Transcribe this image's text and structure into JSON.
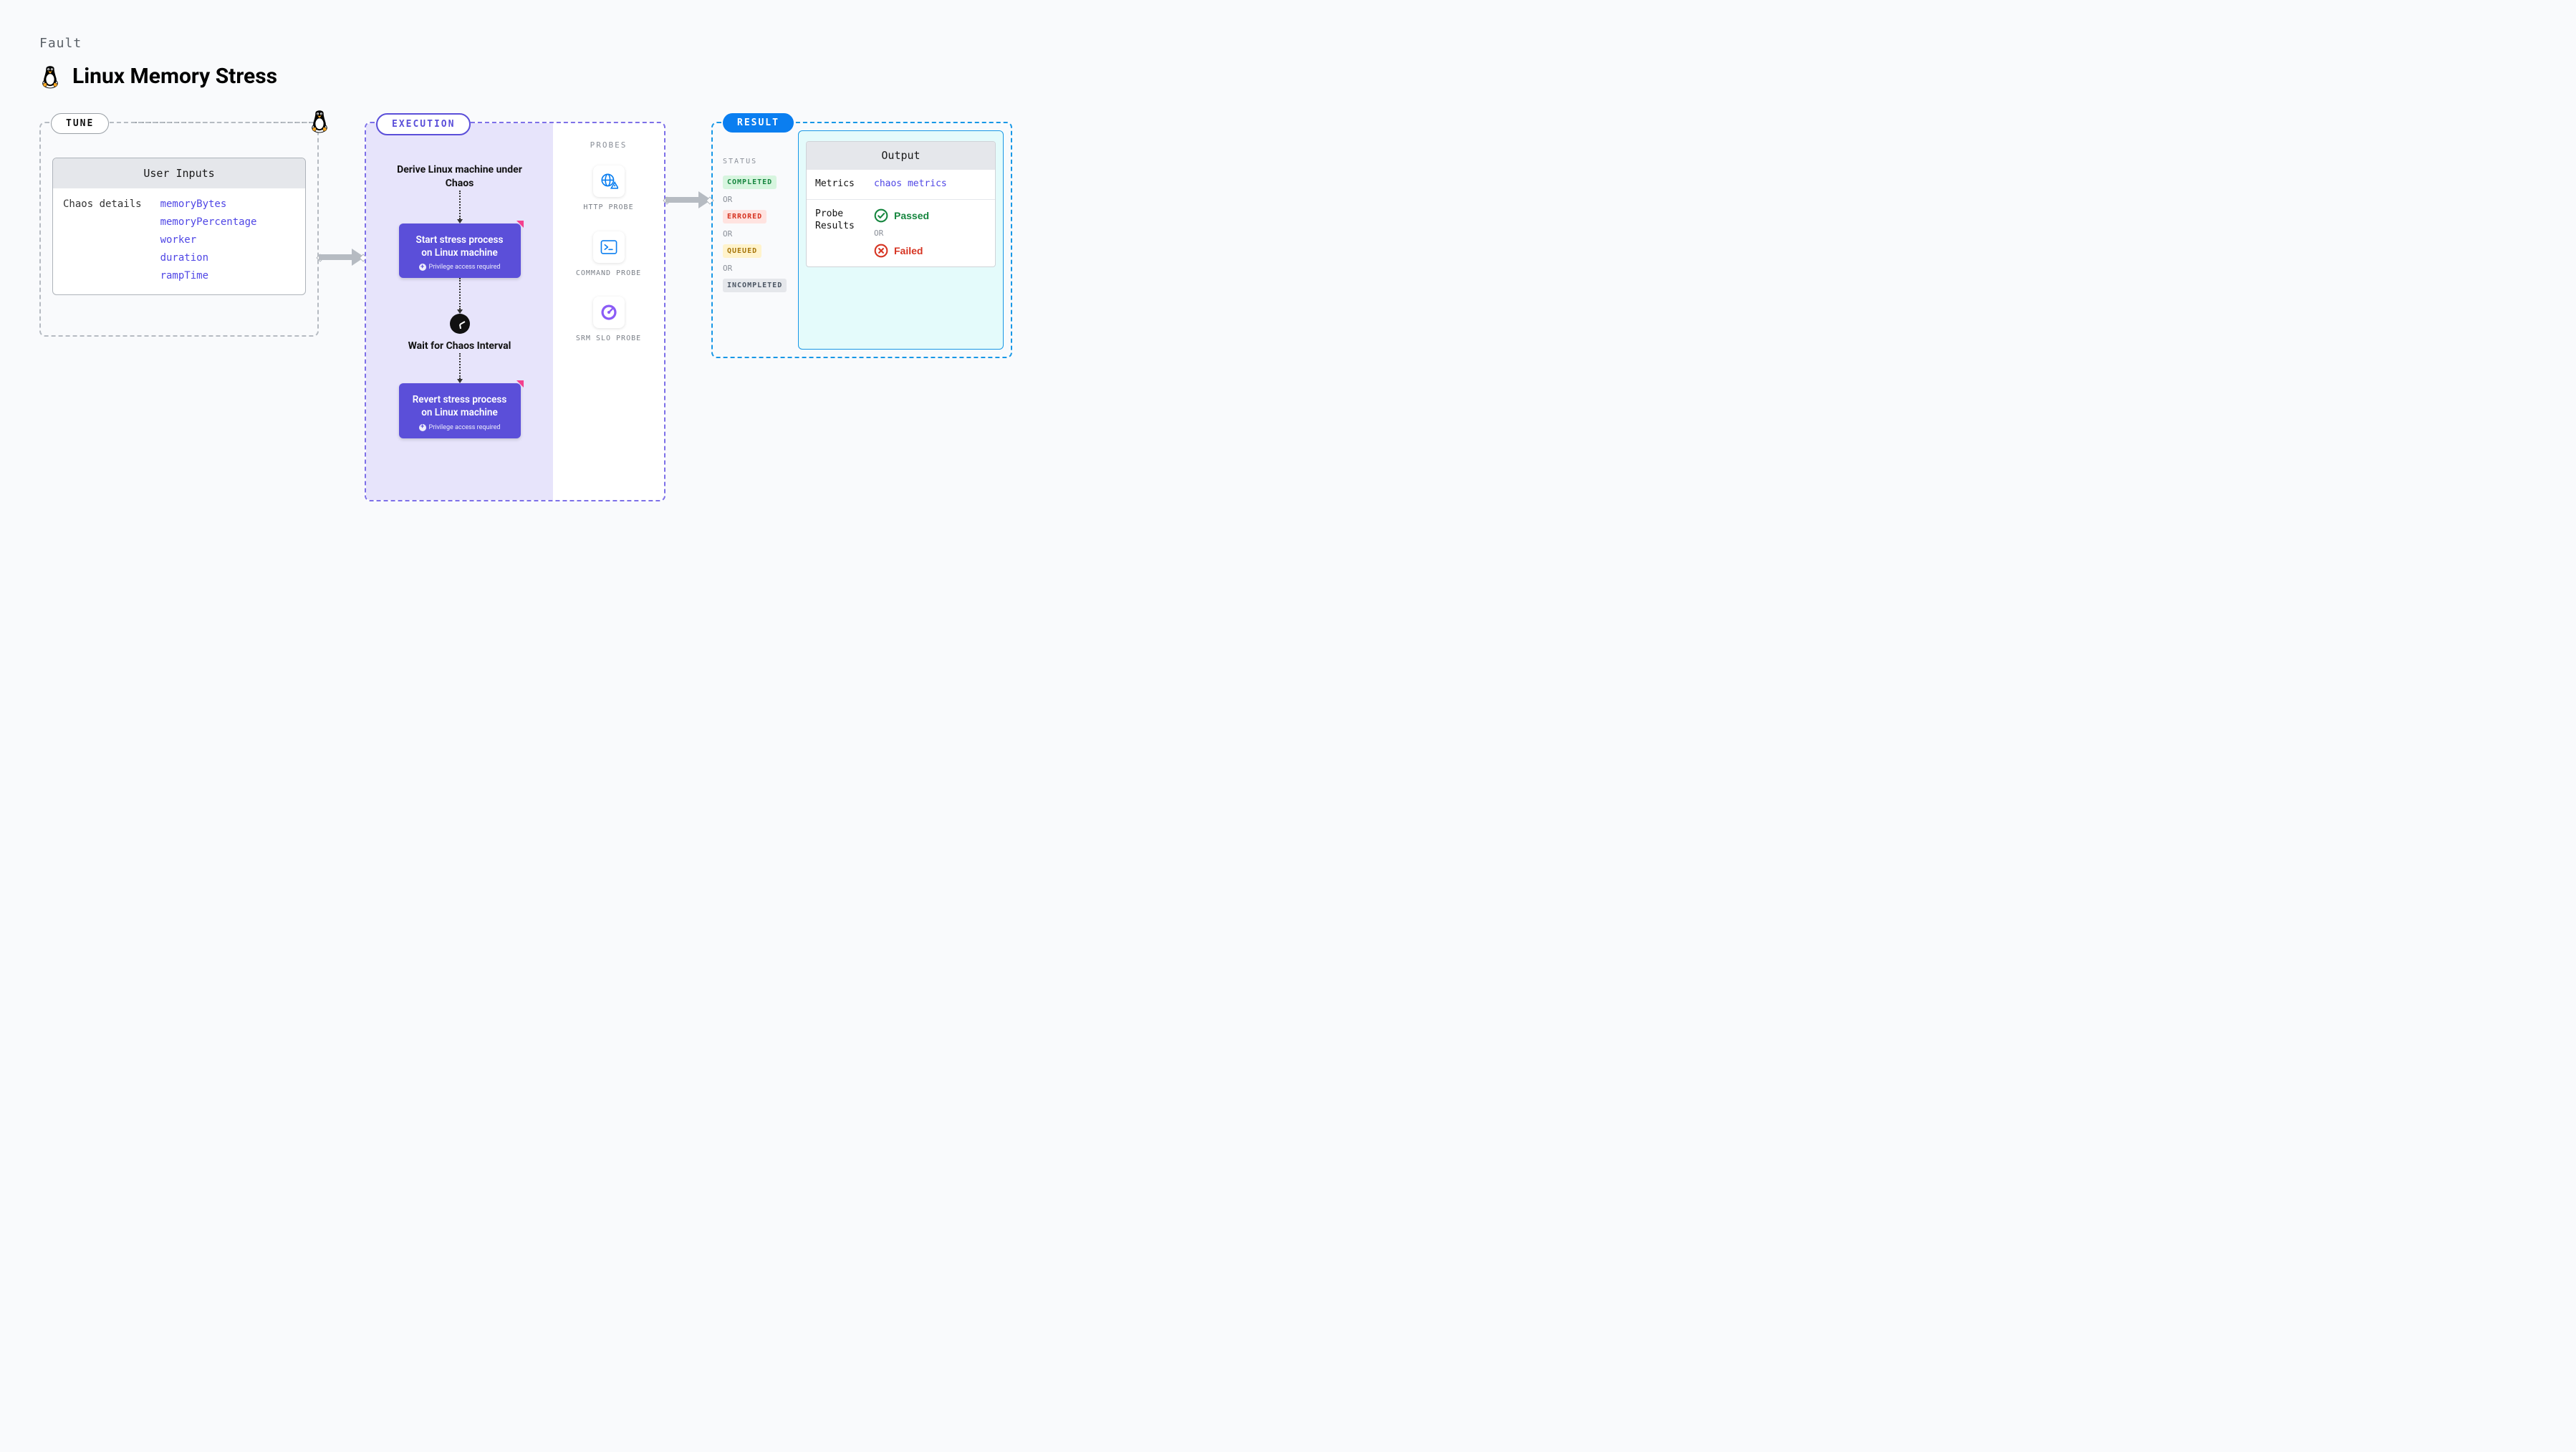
{
  "header": {
    "category": "Fault",
    "title": "Linux Memory Stress"
  },
  "tune": {
    "pill": "TUNE",
    "card_title": "User Inputs",
    "left_label": "Chaos details",
    "inputs": [
      "memoryBytes",
      "memoryPercentage",
      "worker",
      "duration",
      "rampTime"
    ]
  },
  "execution": {
    "pill": "EXECUTION",
    "step1": "Derive Linux machine under Chaos",
    "step2_title": "Start stress process on Linux machine",
    "step2_sub": "Privilege access required",
    "step3": "Wait for Chaos Interval",
    "step4_title": "Revert stress process on Linux machine",
    "step4_sub": "Privilege access required",
    "probes_title": "PROBES",
    "probes": [
      {
        "id": "http-probe",
        "label": "HTTP PROBE"
      },
      {
        "id": "command-probe",
        "label": "COMMAND PROBE"
      },
      {
        "id": "srm-slo-probe",
        "label": "SRM SLO PROBE"
      }
    ]
  },
  "result": {
    "pill": "RESULT",
    "status_title": "STATUS",
    "or": "OR",
    "statuses": [
      "COMPLETED",
      "ERRORED",
      "QUEUED",
      "INCOMPLETED"
    ],
    "output_title": "Output",
    "metrics_label": "Metrics",
    "metrics_value": "chaos metrics",
    "probe_results_label": "Probe Results",
    "passed": "Passed",
    "failed": "Failed"
  }
}
